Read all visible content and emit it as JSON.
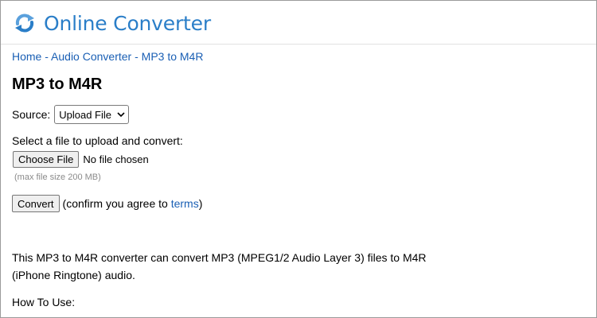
{
  "site": {
    "title": "Online Converter"
  },
  "breadcrumb": {
    "items": [
      "Home",
      "Audio Converter",
      "MP3 to M4R"
    ],
    "separator": " - "
  },
  "page": {
    "title": "MP3 to M4R"
  },
  "form": {
    "source_label": "Source:",
    "source_selected": "Upload File",
    "select_file_label": "Select a file to upload and convert:",
    "choose_file_label": "Choose File",
    "no_file_text": "No file chosen",
    "max_size_note": "(max file size 200 MB)",
    "convert_label": "Convert",
    "confirm_prefix": "(confirm you agree to ",
    "terms_link": "terms",
    "confirm_suffix": ")"
  },
  "content": {
    "description": "This MP3 to M4R converter can convert MP3 (MPEG1/2 Audio Layer 3) files to M4R (iPhone Ringtone) audio.",
    "how_to_heading": "How To Use:"
  },
  "colors": {
    "brand": "#2a7ec8",
    "link": "#1a5fb4",
    "muted": "#8a8a8a"
  },
  "icons": {
    "logo": "refresh-arrows-icon",
    "select": "chevron-down-icon"
  }
}
